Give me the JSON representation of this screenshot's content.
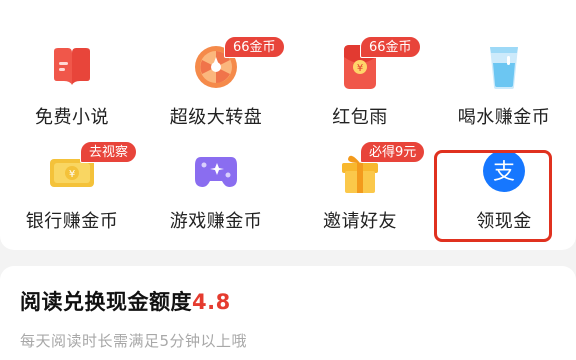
{
  "grid": {
    "row1": [
      {
        "label": "免费小说",
        "badge": ""
      },
      {
        "label": "超级大转盘",
        "badge": "66金币"
      },
      {
        "label": "红包雨",
        "badge": "66金币"
      },
      {
        "label": "喝水赚金币",
        "badge": ""
      }
    ],
    "row2": [
      {
        "label": "银行赚金币",
        "badge": "去视察"
      },
      {
        "label": "游戏赚金币",
        "badge": ""
      },
      {
        "label": "邀请好友",
        "badge": "必得9元"
      },
      {
        "label": "领现金",
        "badge": ""
      }
    ]
  },
  "cash": {
    "title": "阅读兑换现金额度",
    "amount": "4.8",
    "subtitle": "每天阅读时长需满足5分钟以上哦"
  },
  "colors": {
    "accent": "#e53b2f",
    "badge": "#e8443a",
    "alipay": "#1677ff"
  }
}
